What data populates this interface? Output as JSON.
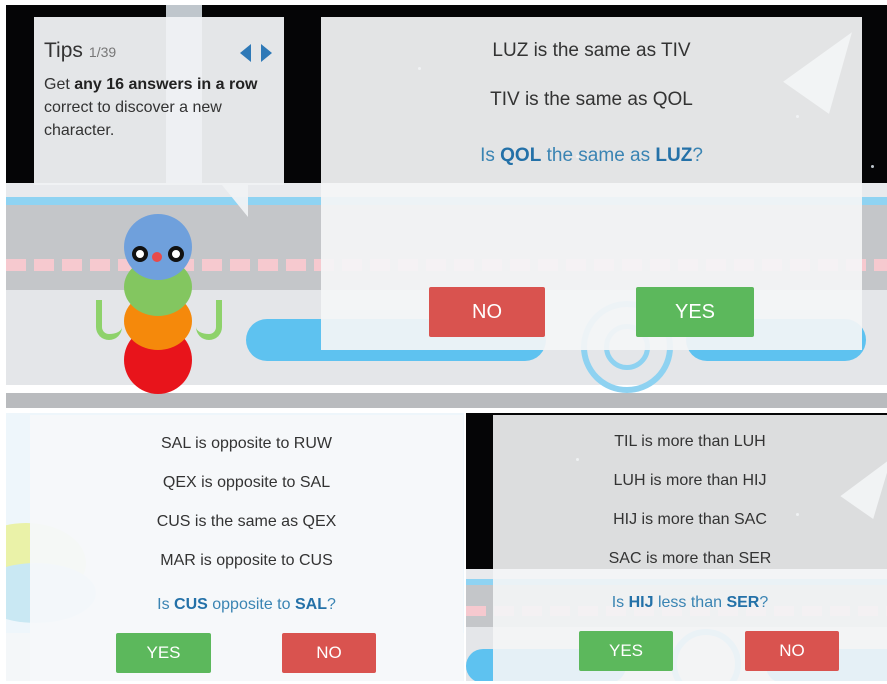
{
  "tips": {
    "title": "Tips",
    "counter": "1/39",
    "text_before": "Get ",
    "text_bold": "any 16 answers in a row",
    "text_after": " correct to discover a new character."
  },
  "icons": {
    "prev": "caret-left-icon",
    "next": "caret-right-icon"
  },
  "puzzle_main": {
    "premises": [
      "LUZ is the same as TIV",
      "TIV is the same as QOL"
    ],
    "question": {
      "pre": "Is ",
      "a": "QOL",
      "mid": " the same as ",
      "b": "LUZ",
      "post": "?"
    },
    "no_label": "NO",
    "yes_label": "YES"
  },
  "puzzle_left": {
    "premises": [
      "SAL is opposite to RUW",
      "QEX is opposite to SAL",
      "CUS is the same as QEX",
      "MAR is opposite to CUS"
    ],
    "question": {
      "pre": "Is ",
      "a": "CUS",
      "mid": " opposite to ",
      "b": "SAL",
      "post": "?"
    },
    "yes_label": "YES",
    "no_label": "NO"
  },
  "puzzle_right": {
    "premises": [
      "TIL is more than LUH",
      "LUH is more than HIJ",
      "HIJ is more than SAC",
      "SAC is more than SER"
    ],
    "question": {
      "pre": "Is ",
      "a": "HIJ",
      "mid": " less than ",
      "b": "SER",
      "post": "?"
    },
    "yes_label": "YES",
    "no_label": "NO"
  },
  "colors": {
    "no": "#d9534f",
    "yes": "#5cb85c",
    "highlight": "#2471a8",
    "question": "#3a84b3",
    "space": "#050506"
  }
}
